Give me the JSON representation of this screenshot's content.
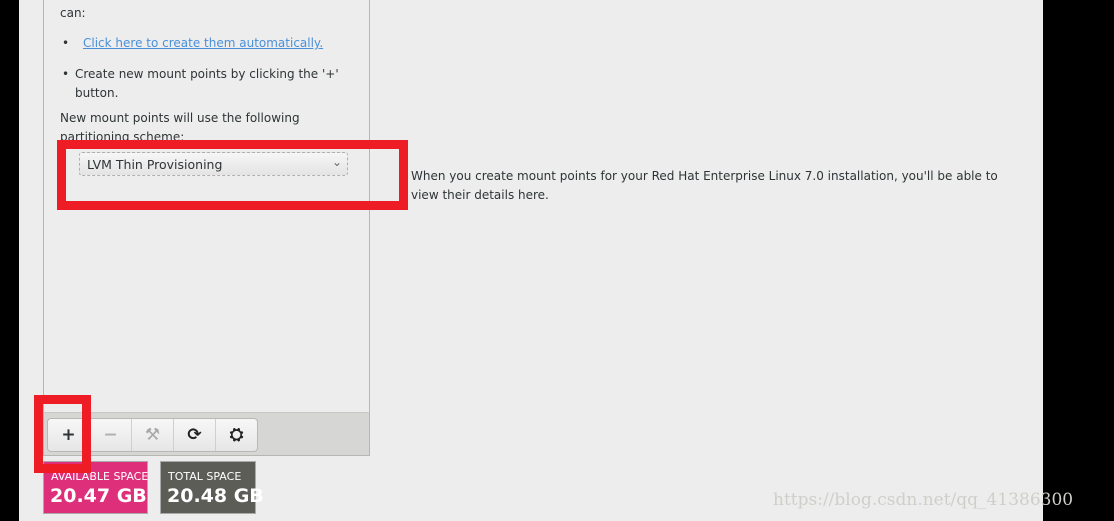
{
  "left_panel": {
    "intro_tail": "can:",
    "auto_link": "Click here to create them automatically.",
    "manual_hint_line1": "Create new mount points by clicking the '+'",
    "manual_hint_line2": "button.",
    "scheme_label_line1": "New mount points will use the following",
    "scheme_label_line2": "partitioning scheme:",
    "scheme_selected": "LVM Thin Provisioning"
  },
  "toolbar": {
    "buttons": [
      {
        "icon": "plus-icon",
        "glyph": "+"
      },
      {
        "icon": "minus-icon",
        "glyph": "−"
      },
      {
        "icon": "tools-icon",
        "glyph": "⚒"
      },
      {
        "icon": "refresh-icon",
        "glyph": "⟳"
      },
      {
        "icon": "disk-icon",
        "glyph": "⛭"
      }
    ]
  },
  "space": {
    "available_label": "AVAILABLE SPACE",
    "available_value": "20.47 GB",
    "available_color": "#dd2f7a",
    "total_label": "TOTAL SPACE",
    "total_value": "20.48 GB",
    "total_color": "#5d5d58"
  },
  "details": {
    "line1": "When you create mount points for your Red Hat Enterprise Linux 7.0 installation, you'll be able to",
    "line2": "view their details here."
  },
  "watermark": "https://blog.csdn.net/qq_41386300"
}
